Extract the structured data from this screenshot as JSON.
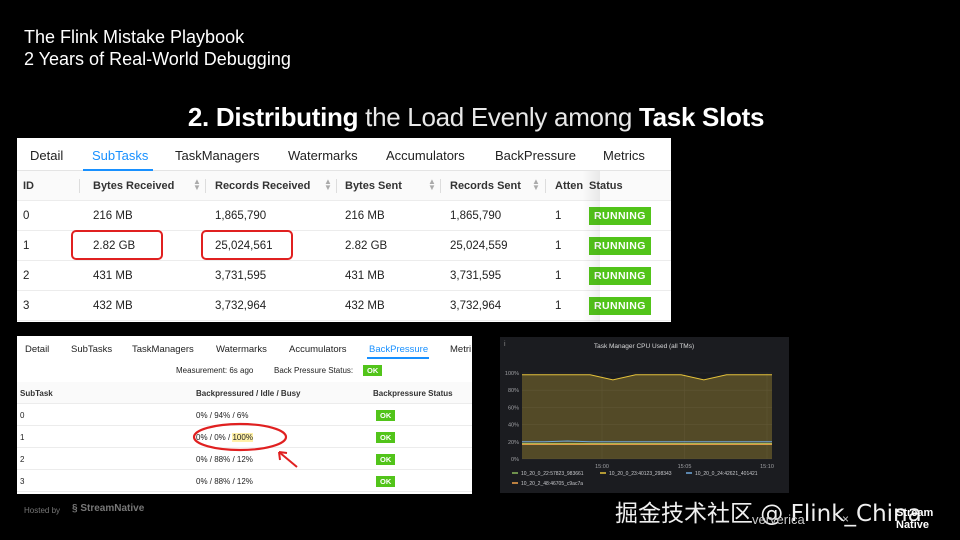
{
  "talk": {
    "title_line1": "The Flink Mistake Playbook",
    "title_line2": "2 Years of Real-World Debugging"
  },
  "headline": {
    "number": "2.",
    "bold1": "Distributing",
    "light": "the Load Evenly among",
    "bold2": "Task Slots"
  },
  "subtasks_panel": {
    "tabs": [
      "Detail",
      "SubTasks",
      "TaskManagers",
      "Watermarks",
      "Accumulators",
      "BackPressure",
      "Metrics"
    ],
    "active_tab": "SubTasks",
    "columns": [
      "ID",
      "Bytes Received",
      "Records Received",
      "Bytes Sent",
      "Records Sent",
      "Atten",
      "Status"
    ],
    "rows": [
      {
        "id": "0",
        "bytes_received": "216 MB",
        "records_received": "1,865,790",
        "bytes_sent": "216 MB",
        "records_sent": "1,865,790",
        "attempt": "1",
        "status": "RUNNING"
      },
      {
        "id": "1",
        "bytes_received": "2.82 GB",
        "records_received": "25,024,561",
        "bytes_sent": "2.82 GB",
        "records_sent": "25,024,559",
        "attempt": "1",
        "status": "RUNNING"
      },
      {
        "id": "2",
        "bytes_received": "431 MB",
        "records_received": "3,731,595",
        "bytes_sent": "431 MB",
        "records_sent": "3,731,595",
        "attempt": "1",
        "status": "RUNNING"
      },
      {
        "id": "3",
        "bytes_received": "432 MB",
        "records_received": "3,732,964",
        "bytes_sent": "432 MB",
        "records_sent": "3,732,964",
        "attempt": "1",
        "status": "RUNNING"
      }
    ],
    "status_color": "#52c41a",
    "highlight_color": "#e02020"
  },
  "backpressure_panel": {
    "tabs": [
      "Detail",
      "SubTasks",
      "TaskManagers",
      "Watermarks",
      "Accumulators",
      "BackPressure",
      "Metri"
    ],
    "active_tab": "BackPressure",
    "measurement": "Measurement: 6s ago",
    "status_label": "Back Pressure Status:",
    "status_value": "OK",
    "columns": [
      "SubTask",
      "Backpressured / Idle / Busy",
      "Backpressure Status"
    ],
    "rows": [
      {
        "subtask": "0",
        "bp": "0% / 94% / 6%",
        "status": "OK"
      },
      {
        "subtask": "1",
        "bp_prefix": "0% / 0% / ",
        "bp_busy": "100%",
        "status": "OK"
      },
      {
        "subtask": "2",
        "bp": "0% / 88% / 12%",
        "status": "OK"
      },
      {
        "subtask": "3",
        "bp": "0% / 88% / 12%",
        "status": "OK"
      }
    ]
  },
  "cpu_chart": {
    "panel_icon": "info-icon",
    "chart_data": {
      "type": "line",
      "title": "Task Manager CPU Used (all TMs)",
      "ylim": [
        0,
        100
      ],
      "y_ticks": [
        "0%",
        "20%",
        "40%",
        "60%",
        "80%",
        "100%"
      ],
      "x_ticks": [
        "15:00",
        "15:05",
        "15:10"
      ],
      "series": [
        {
          "name": "10_20_0_22:57823_983661",
          "color": "#8ab85a",
          "values": [
            18,
            18,
            18,
            18,
            18,
            18,
            18,
            18,
            18,
            18,
            18,
            18
          ]
        },
        {
          "name": "10_20_0_23:40123_298343",
          "color": "#e5c23a",
          "values": [
            98,
            98,
            98,
            98,
            92,
            98,
            98,
            98,
            92,
            98,
            98,
            98
          ]
        },
        {
          "name": "10_20_0_24:42621_401421",
          "color": "#6fa8dc",
          "values": [
            20,
            20,
            21,
            20,
            20,
            20,
            20,
            20,
            20,
            20,
            20,
            20
          ]
        },
        {
          "name": "10_20_2_48:46705_c9ac7a",
          "color": "#f2a24b",
          "values": [
            17,
            17,
            17,
            17,
            17,
            17,
            17,
            17,
            17,
            17,
            17,
            17
          ]
        }
      ],
      "grid": true,
      "legend": "bottom"
    }
  },
  "footer": {
    "hosted_by": "Hosted by",
    "hosted_brand": "StreamNative",
    "watermark": "掘金技术社区 @ Flink_China",
    "ververica": "ververica",
    "times": "×",
    "sn_line1": "Stream",
    "sn_line2": "Native"
  }
}
